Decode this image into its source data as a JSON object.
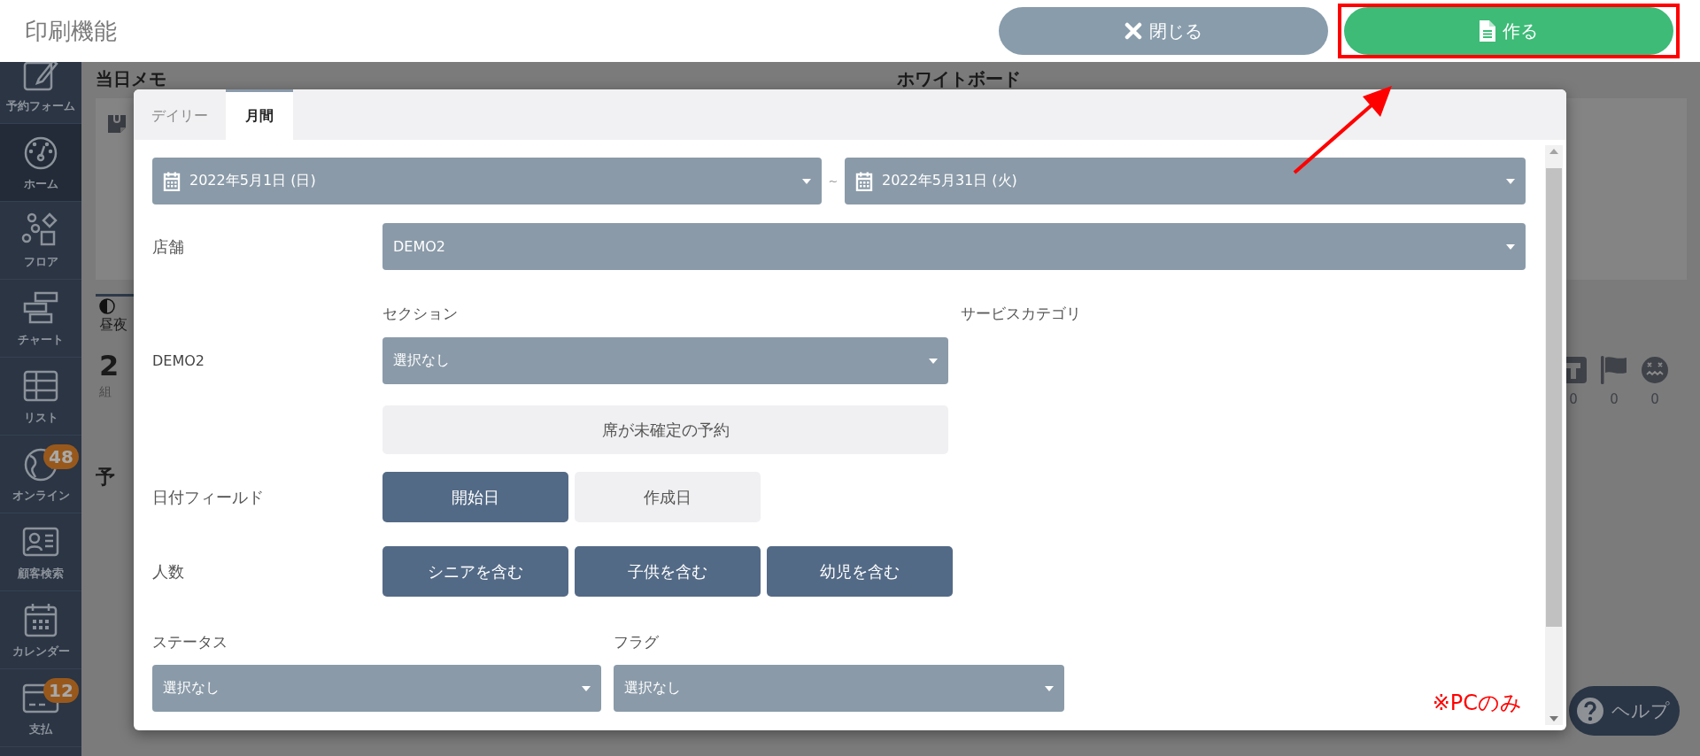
{
  "header": {
    "title": "印刷機能",
    "buttons": [
      {
        "kind": "close",
        "label": "閉じる",
        "highlighted": false
      },
      {
        "kind": "create",
        "label": "作る",
        "highlighted": true
      }
    ]
  },
  "sidebar": {
    "items": [
      {
        "label": "予約フォーム",
        "selected": false
      },
      {
        "label": "ホーム",
        "selected": true
      },
      {
        "label": "フロア",
        "selected": false
      },
      {
        "label": "チャート",
        "selected": false
      },
      {
        "label": "リスト",
        "selected": false
      },
      {
        "label": "オンライン",
        "selected": false,
        "badge": "48"
      },
      {
        "label": "顧客検索",
        "selected": false
      },
      {
        "label": "カレンダー",
        "selected": false
      },
      {
        "label": "支払",
        "selected": false,
        "badge": "12"
      }
    ]
  },
  "background": {
    "memo_title": "当日メモ",
    "whiteboard_title": "ホワイトボード",
    "tab_label": "昼夜",
    "count": "2",
    "count_unit": "組",
    "section_title": "予",
    "stats": [
      {
        "count": "0"
      },
      {
        "count": "0"
      },
      {
        "count": "0"
      }
    ],
    "help_button": "ヘルプ"
  },
  "dialog": {
    "tabs": [
      {
        "label": "デイリー",
        "selected": false
      },
      {
        "label": "月間",
        "selected": true
      }
    ],
    "date_range": {
      "start": "2022年5月1日 (日)",
      "separator": "~",
      "end": "2022年5月31日 (火)"
    },
    "store": {
      "label": "店舗",
      "value": "DEMO2"
    },
    "store_section": {
      "store_name": "DEMO2",
      "section_label": "セクション",
      "section_value": "選択なし",
      "category_label": "サービスカテゴリ",
      "unassigned_toggle": {
        "label": "席が未確定の予約",
        "selected": false
      }
    },
    "date_field": {
      "label": "日付フィールド",
      "options": [
        {
          "label": "開始日",
          "selected": true
        },
        {
          "label": "作成日",
          "selected": false
        }
      ]
    },
    "people": {
      "label": "人数",
      "options": [
        {
          "label": "シニアを含む",
          "selected": true
        },
        {
          "label": "子供を含む",
          "selected": true
        },
        {
          "label": "幼児を含む",
          "selected": true
        }
      ]
    },
    "status": {
      "label": "ステータス",
      "value": "選択なし"
    },
    "flag": {
      "label": "フラグ",
      "value": "選択なし"
    },
    "note": "※PCのみ"
  }
}
